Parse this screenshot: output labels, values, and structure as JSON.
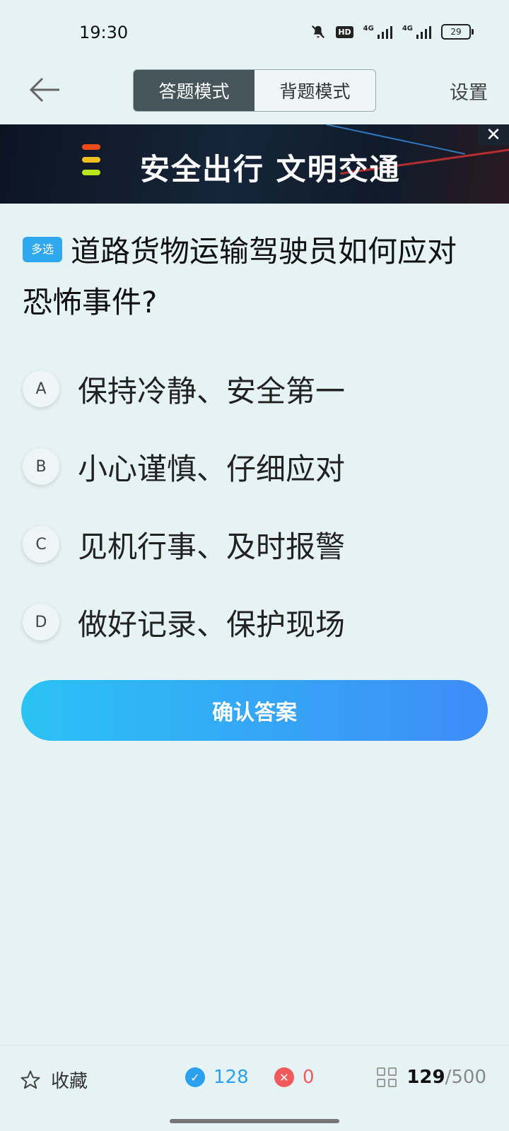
{
  "status": {
    "time": "19:30",
    "hd": "HD",
    "net1": "4G",
    "net2": "4G",
    "battery": "29"
  },
  "header": {
    "mode_answer": "答题模式",
    "mode_recite": "背题模式",
    "settings": "设置"
  },
  "banner": {
    "text": "安全出行 文明交通",
    "close": "✕"
  },
  "question": {
    "tag": "多选",
    "text": "道路货物运输驾驶员如何应对恐怖事件?"
  },
  "options": [
    {
      "letter": "A",
      "text": "保持冷静、安全第一"
    },
    {
      "letter": "B",
      "text": "小心谨慎、仔细应对"
    },
    {
      "letter": "C",
      "text": "见机行事、及时报警"
    },
    {
      "letter": "D",
      "text": "做好记录、保护现场"
    }
  ],
  "confirm_label": "确认答案",
  "bottom": {
    "favorite": "收藏",
    "correct": "128",
    "wrong": "0",
    "current": "129",
    "total": "/500"
  },
  "colors": {
    "accent": "#2fa8f0",
    "correct": "#2aa0ee",
    "wrong": "#f05a5a",
    "active_tab": "#465559"
  }
}
